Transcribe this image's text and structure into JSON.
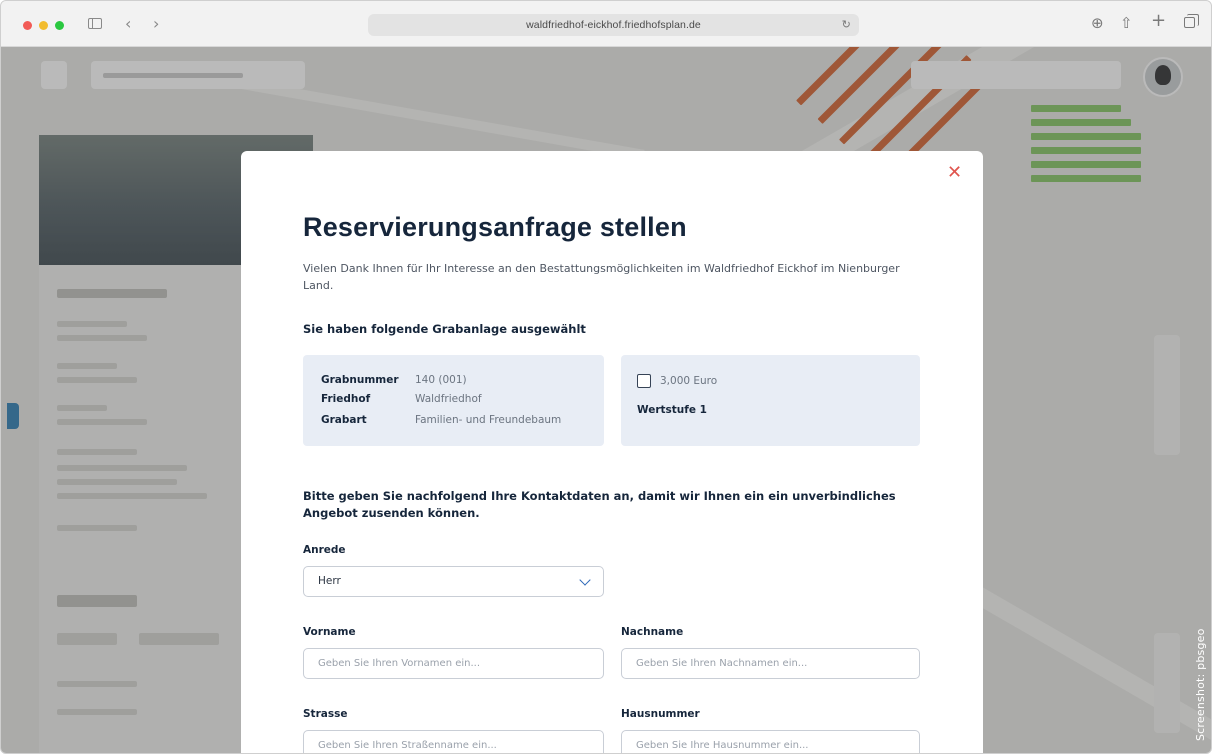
{
  "browser": {
    "url": "waldfriedhof-eickhof.friedhofsplan.de",
    "icons": [
      "sidebar-toggle-icon",
      "back-icon",
      "forward-icon",
      "reload-icon",
      "download-icon",
      "share-icon",
      "new-tab-icon",
      "tab-overview-icon"
    ]
  },
  "modal": {
    "title": "Reservierungsanfrage stellen",
    "intro": "Vielen Dank Ihnen für Ihr Interesse an den Bestattungsmöglichkeiten im Waldfriedhof Eickhof im Nienburger Land.",
    "selection_heading": "Sie haben folgende Grabanlage ausgewählt",
    "grave": [
      {
        "key": "Grabnummer",
        "value": "140 (001)"
      },
      {
        "key": "Friedhof",
        "value": "Waldfriedhof"
      },
      {
        "key": "Grabart",
        "value": "Familien- und Freundebaum"
      }
    ],
    "price": "3,000 Euro",
    "tier": "Wertstufe 1",
    "contact_heading": "Bitte geben Sie nachfolgend Ihre Kontaktdaten an, damit wir Ihnen ein ein unverbindliches Angebot zusenden können.",
    "form": {
      "anrede_label": "Anrede",
      "anrede_value": "Herr",
      "vorname_label": "Vorname",
      "vorname_placeholder": "Geben Sie Ihren Vornamen ein...",
      "nachname_label": "Nachname",
      "nachname_placeholder": "Geben Sie Ihren Nachnamen ein...",
      "strasse_label": "Strasse",
      "strasse_placeholder": "Geben Sie Ihren Straßenname ein...",
      "hausnummer_label": "Hausnummer",
      "hausnummer_placeholder": "Geben Sie Ihre Hausnummer ein..."
    }
  },
  "credit": "Screenshot: pbsgeo",
  "colors": {
    "title": "#16263b",
    "card_bg": "#e8edf5",
    "close": "#e0554e",
    "accent": "#2e69b8"
  }
}
